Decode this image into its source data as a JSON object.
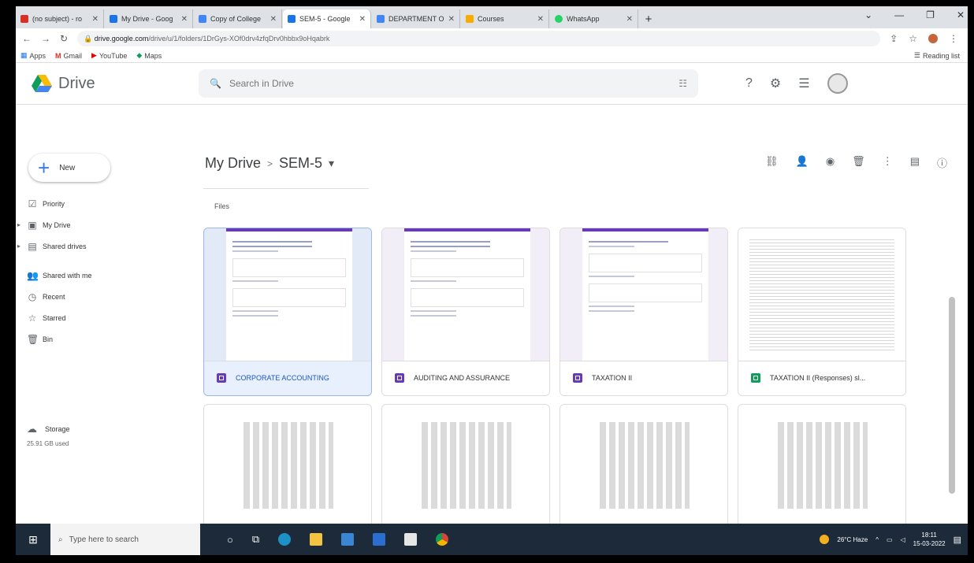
{
  "browser": {
    "tabs": [
      {
        "label": "(no subject) - ro",
        "favicon": "gmail-icon",
        "color": "#d93025",
        "active": false
      },
      {
        "label": "My Drive - Goog",
        "favicon": "drive-icon",
        "color": "#1a73e8",
        "active": false
      },
      {
        "label": "Copy of College",
        "favicon": "docs-icon",
        "color": "#4285f4",
        "active": false
      },
      {
        "label": "SEM-5 - Google",
        "favicon": "drive-icon",
        "color": "#1a73e8",
        "active": true
      },
      {
        "label": "DEPARTMENT O",
        "favicon": "docs-icon",
        "color": "#4285f4",
        "active": false
      },
      {
        "label": "Courses",
        "favicon": "classroom-icon",
        "color": "#f9ab00",
        "active": false
      },
      {
        "label": "WhatsApp",
        "favicon": "whatsapp-icon",
        "color": "#25d366",
        "active": false
      }
    ],
    "new_tab": "+",
    "url_domain": "drive.google.com",
    "url_path": "/drive/u/1/folders/1DrGys-XOf0drv4zfqDrv0hbbx9oHqabrk",
    "bookmarks": [
      "Apps",
      "Gmail",
      "YouTube",
      "Maps"
    ],
    "reading_list": "Reading list"
  },
  "drive": {
    "product": "Drive",
    "search_placeholder": "Search in Drive",
    "new_label": "New",
    "nav": [
      "Priority",
      "My Drive",
      "Shared drives",
      "Shared with me",
      "Recent",
      "Starred",
      "Bin"
    ],
    "storage_label": "Storage",
    "storage_used": "25.91 GB used",
    "breadcrumb_root": "My Drive",
    "breadcrumb_current": "SEM-5",
    "section_label": "Files",
    "files": [
      {
        "name": "CORPORATE ACCOUNTING",
        "type": "form"
      },
      {
        "name": "AUDITING AND ASSURANCE",
        "type": "form"
      },
      {
        "name": "TAXATION II",
        "type": "form"
      },
      {
        "name": "TAXATION II (Responses) sl...",
        "type": "sheet"
      }
    ]
  },
  "taskbar": {
    "search_placeholder": "Type here to search",
    "weather": "26°C Haze",
    "time": "18:11",
    "date": "15-03-2022"
  }
}
